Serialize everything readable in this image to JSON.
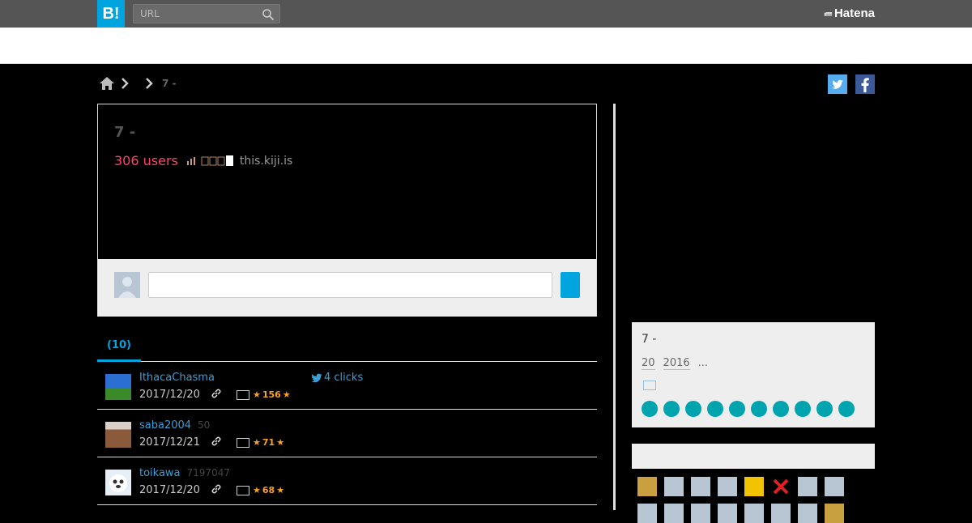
{
  "header": {
    "logo_text": "B!",
    "search_placeholder": "URL",
    "brand": "Hatena"
  },
  "breadcrumb": {
    "title": "7 -"
  },
  "entry": {
    "title": "7 -",
    "users": "306 users",
    "domain": "this.kiji.is"
  },
  "tabs": [
    {
      "label": "(10)"
    }
  ],
  "bookmarks": [
    {
      "user": "IthacaChasma",
      "count": "",
      "clicks": "4 clicks",
      "date": "2017/12/20",
      "stars": "156",
      "avatar_color": "#2a6fd1"
    },
    {
      "user": "saba2004",
      "count": "50",
      "clicks": "",
      "date": "2017/12/21",
      "stars": "71",
      "avatar_color": "#8a6a4a"
    },
    {
      "user": "toikawa",
      "count": "7197047",
      "clicks": "",
      "date": "2017/12/20",
      "stars": "68",
      "avatar_color": "#e8eef5"
    }
  ],
  "sidebar": {
    "entry_title": "7 -",
    "meta": [
      "20",
      "2016",
      "..."
    ]
  },
  "colors": {
    "accent": "#00a4de",
    "users_red": "#ff4166",
    "link_blue": "#3d9ed4",
    "star_orange": "#f6a22a",
    "dot_teal": "#00a4ae"
  }
}
